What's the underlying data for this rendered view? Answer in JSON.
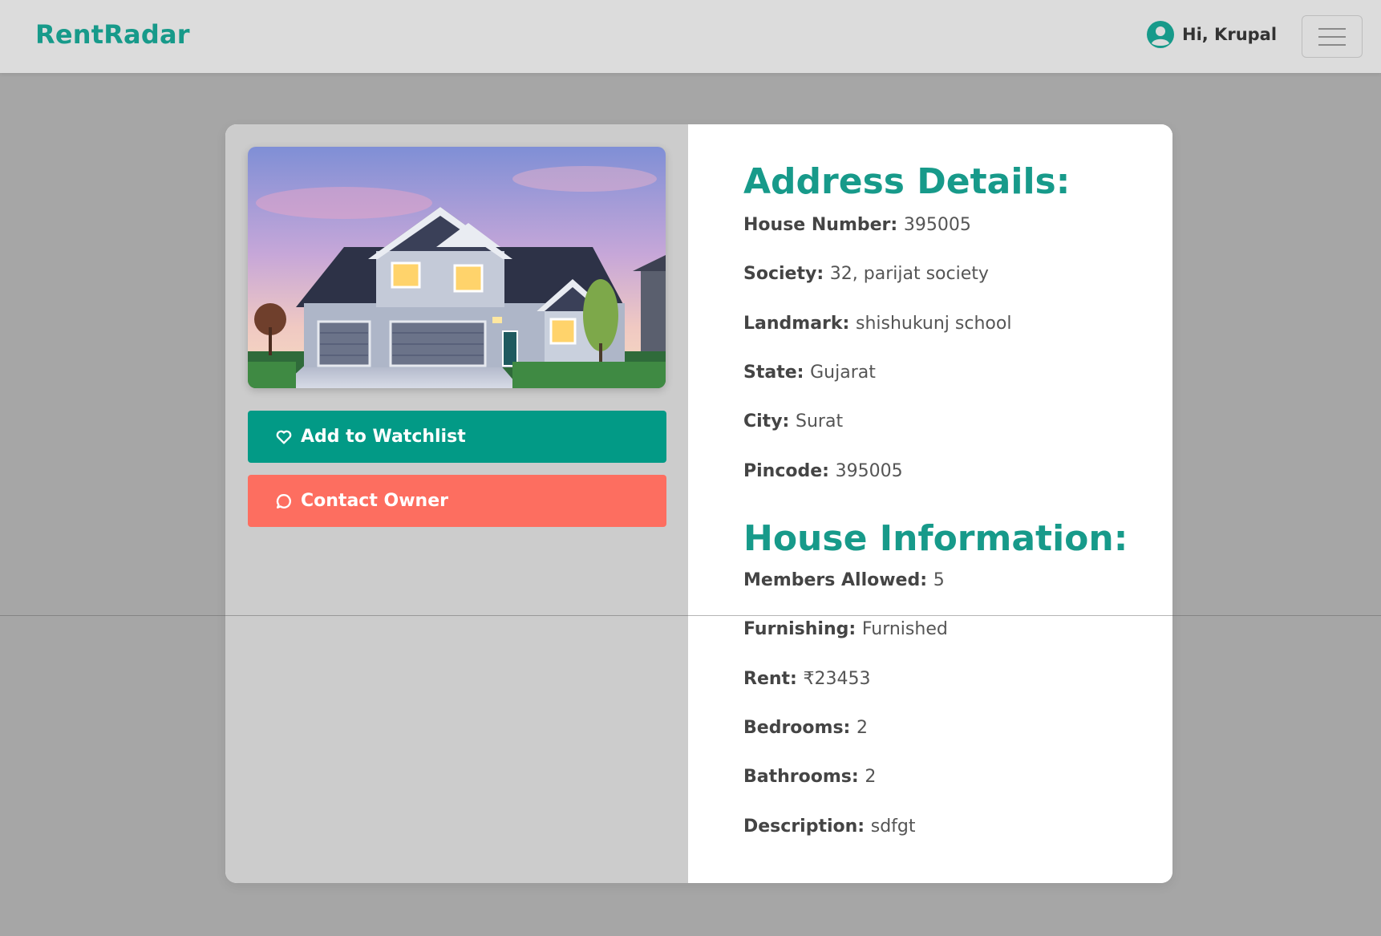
{
  "navbar": {
    "brand": "RentRadar",
    "greeting": "Hi, Krupal",
    "user_icon": "user-circle-icon",
    "menu_icon": "hamburger-icon"
  },
  "colors": {
    "brand": "#179a8a",
    "watchlist_button": "#029a86",
    "contact_button": "#fd6e60",
    "left_panel": "#cccccc",
    "page_background": "#a6a6a6",
    "navbar": "#dcdcdc"
  },
  "actions": {
    "watchlist_label": "Add to Watchlist",
    "watchlist_icon": "heart-icon",
    "contact_label": "Contact Owner",
    "contact_icon": "chat-bubble-icon"
  },
  "address": {
    "title": "Address Details:",
    "items": [
      {
        "label": "House Number:",
        "value": "395005"
      },
      {
        "label": "Society:",
        "value": "32, parijat society"
      },
      {
        "label": "Landmark:",
        "value": "shishukunj school"
      },
      {
        "label": "State:",
        "value": "Gujarat"
      },
      {
        "label": "City:",
        "value": "Surat"
      },
      {
        "label": "Pincode:",
        "value": "395005"
      }
    ]
  },
  "house": {
    "title": "House Information:",
    "items": [
      {
        "label": "Members Allowed:",
        "value": "5"
      },
      {
        "label": "Furnishing:",
        "value": "Furnished"
      },
      {
        "label": "Rent:",
        "value": "₹23453"
      },
      {
        "label": "Bedrooms:",
        "value": "2"
      },
      {
        "label": "Bathrooms:",
        "value": "2"
      },
      {
        "label": "Description:",
        "value": "sdfgt"
      }
    ]
  }
}
